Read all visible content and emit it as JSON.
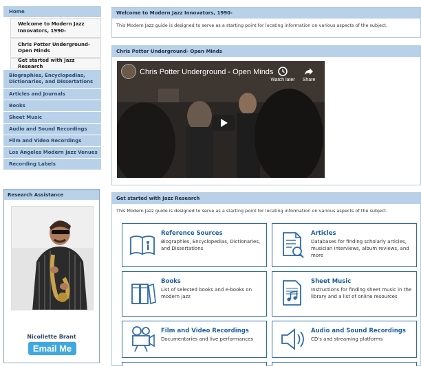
{
  "nav": {
    "items": [
      {
        "label": "Home"
      },
      {
        "label": "Welcome to Modern Jazz Innovators, 1990-",
        "sub": true
      },
      {
        "label": "Chris Potter Underground- Open Minds",
        "sub": true
      },
      {
        "label": "Get started with Jazz Research",
        "sub": true
      },
      {
        "label": "Biographies, Encyclopedias, Dictionaries, and Dissertations"
      },
      {
        "label": "Articles and Journals"
      },
      {
        "label": "Books"
      },
      {
        "label": "Sheet Music"
      },
      {
        "label": "Audio and Sound Recordings"
      },
      {
        "label": "Film and Video Recordings"
      },
      {
        "label": "Los Angeles Modern Jazz Venues"
      },
      {
        "label": "Recording Labels"
      }
    ]
  },
  "research": {
    "heading": "Research Assistance",
    "name": "Nicollette Brant",
    "email_label": "Email Me"
  },
  "welcome": {
    "heading": "Welcome to Modern Jazz Innovators, 1990-",
    "text": "This Modern Jazz guide is designed to serve as a starting point for locating information on various aspects of the subject."
  },
  "video_box": {
    "heading": "Chris Potter Underground- Open Minds",
    "video_title": "Chris Potter Underground - Open Minds",
    "watch_later": "Watch later",
    "share": "Share"
  },
  "get_started": {
    "heading": "Get started with Jazz Research",
    "text": "This Modern Jazz guide is designed to serve as a starting point for locating information on various aspects of the subject.",
    "cards": [
      {
        "title": "Reference Sources",
        "desc": "Biographies, Encyclopedias, Dictionaries, and Dissertations",
        "icon": "book-info-icon"
      },
      {
        "title": "Articles",
        "desc": "Databases for finding scholarly articles, musician interviews, album reviews, and more",
        "icon": "document-search-icon"
      },
      {
        "title": "Books",
        "desc": "List of selected books and e-books on modern jazz",
        "icon": "books-icon"
      },
      {
        "title": "Sheet Music",
        "desc": "Instructions for finding sheet music in the library and a list of online resources",
        "icon": "sheet-music-icon"
      },
      {
        "title": "Film and Video Recordings",
        "desc": "Documentaries and live performances",
        "icon": "film-camera-icon"
      },
      {
        "title": "Audio and Sound Recordings",
        "desc": "CD's and streaming platforms",
        "icon": "speaker-icon"
      }
    ]
  },
  "colors": {
    "nav_bg": "#b8d1e8",
    "card_border": "#2e6aa6",
    "card_title": "#1d5fa0",
    "email_button": "#3fa9df"
  }
}
